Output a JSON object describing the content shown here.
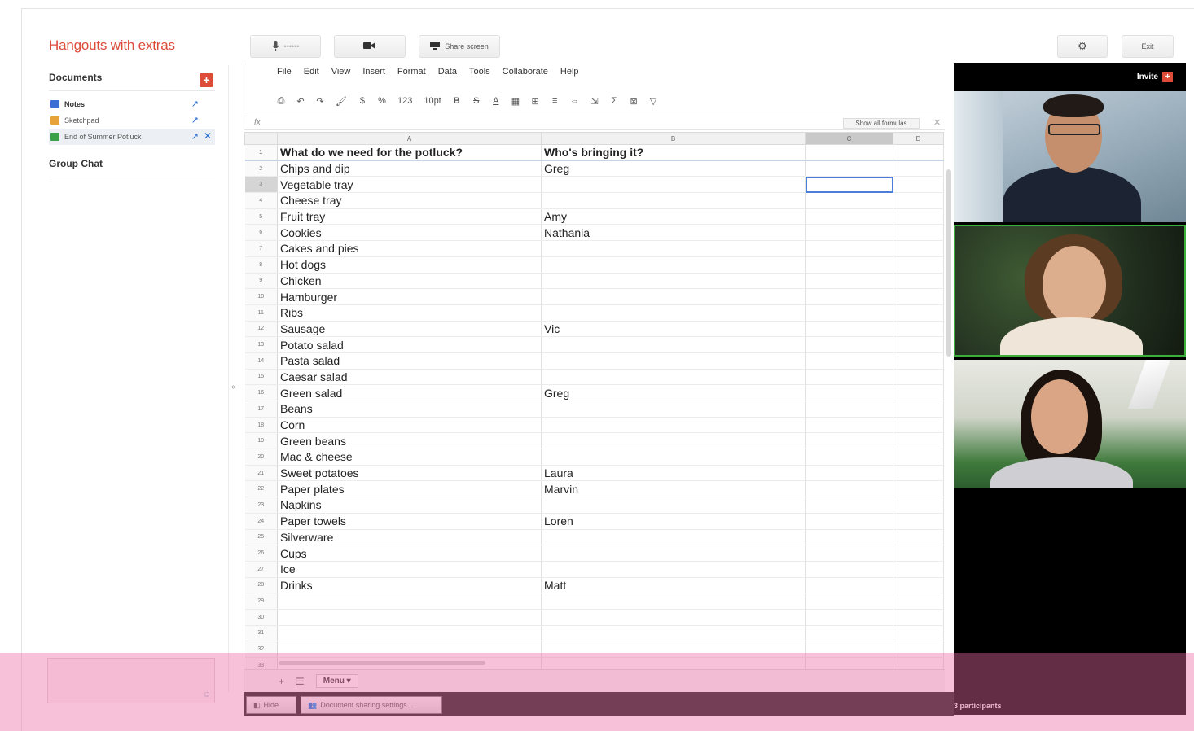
{
  "app": {
    "title": "Hangouts with extras"
  },
  "topbar": {
    "mic_label": "••••••",
    "share_label": "Share screen",
    "settings_icon": "gear-icon",
    "exit_label": "Exit"
  },
  "sidebar": {
    "documents_heading": "Documents",
    "add_icon": "plus-icon",
    "docs": [
      {
        "label": "Notes",
        "color": "#3b6fd6"
      },
      {
        "label": "Sketchpad",
        "color": "#e8a23a"
      },
      {
        "label": "End of Summer Potluck",
        "color": "#3aa04a"
      }
    ],
    "group_chat_heading": "Group Chat"
  },
  "sheet": {
    "menu": [
      "File",
      "Edit",
      "View",
      "Insert",
      "Format",
      "Data",
      "Tools",
      "Collaborate",
      "Help"
    ],
    "toolbar": {
      "zoom_value": "123",
      "font_size": "10pt",
      "sigma": "Σ"
    },
    "fx_label": "fx",
    "show_formulas_label": "Show all formulas",
    "columns": [
      "A",
      "B",
      "C",
      "D"
    ],
    "rows": [
      [
        "What do we need for the potluck?",
        "Who's bringing it?"
      ],
      [
        "Chips and dip",
        "Greg"
      ],
      [
        "Vegetable tray",
        ""
      ],
      [
        "Cheese tray",
        ""
      ],
      [
        "Fruit tray",
        "Amy"
      ],
      [
        "Cookies",
        "Nathania"
      ],
      [
        "Cakes and pies",
        ""
      ],
      [
        "Hot dogs",
        ""
      ],
      [
        "Chicken",
        ""
      ],
      [
        "Hamburger",
        ""
      ],
      [
        "Ribs",
        ""
      ],
      [
        "Sausage",
        "Vic"
      ],
      [
        "Potato salad",
        ""
      ],
      [
        "Pasta salad",
        ""
      ],
      [
        "Caesar salad",
        ""
      ],
      [
        "Green salad",
        "Greg"
      ],
      [
        "Beans",
        ""
      ],
      [
        "Corn",
        ""
      ],
      [
        "Green beans",
        ""
      ],
      [
        "Mac & cheese",
        ""
      ],
      [
        "Sweet potatoes",
        "Laura"
      ],
      [
        "Paper plates",
        "Marvin"
      ],
      [
        "Napkins",
        ""
      ],
      [
        "Paper towels",
        "Loren"
      ],
      [
        "Silverware",
        ""
      ],
      [
        "Cups",
        ""
      ],
      [
        "Ice",
        ""
      ],
      [
        "Drinks",
        "Matt"
      ],
      [
        "",
        ""
      ],
      [
        "",
        ""
      ],
      [
        "",
        ""
      ],
      [
        "",
        ""
      ],
      [
        "",
        ""
      ]
    ],
    "tab_menu_label": "Menu ▾"
  },
  "video": {
    "invite_label": "Invite",
    "participants_label": "3 participants"
  },
  "bottom": {
    "hide_label": "Hide",
    "doc_share_label": "Document sharing settings..."
  },
  "colors": {
    "accent": "#dd4b39",
    "link": "#2a6fd0",
    "active_speaker": "#3cae3c"
  }
}
